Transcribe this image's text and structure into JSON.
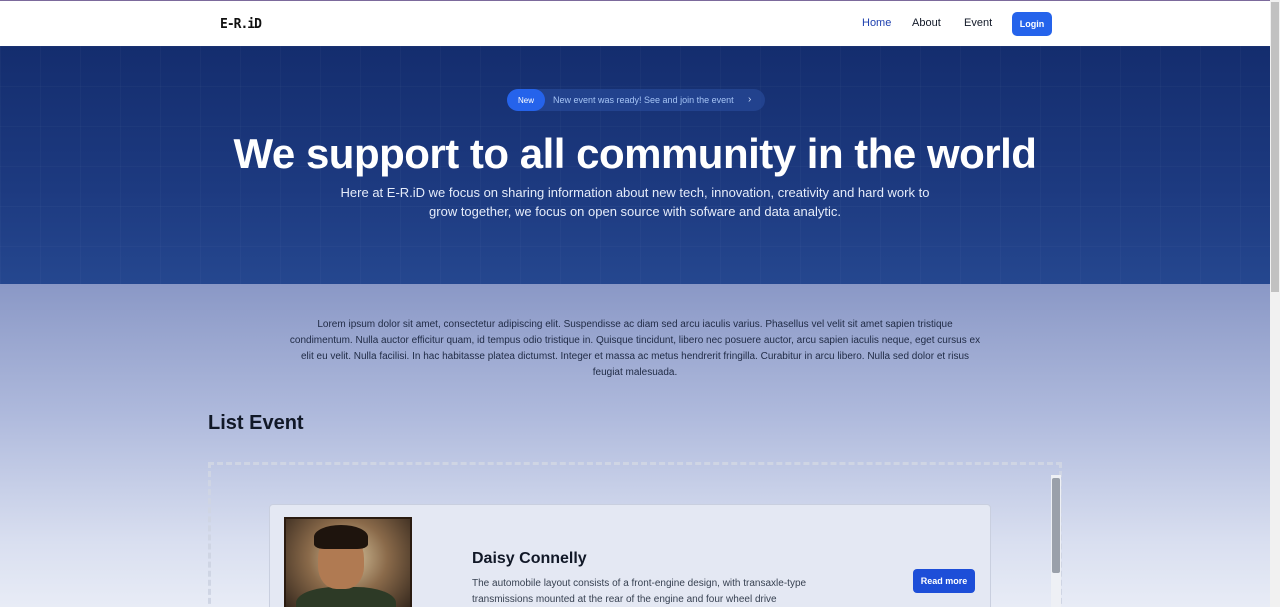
{
  "navbar": {
    "logo": "E-R.iD",
    "links": [
      {
        "label": "Home",
        "active": true
      },
      {
        "label": "About",
        "active": false
      },
      {
        "label": "Event",
        "active": false
      }
    ],
    "login_label": "Login"
  },
  "hero": {
    "badge": "New",
    "announcement": "New event was ready! See and join the event",
    "announcement_icon": "chevron-right-icon",
    "title": "We support to all community in the world",
    "description": "Here at E-R.iD we focus on sharing information about new tech, innovation, creativity and hard work to grow together, we focus on open source with sofware and data analytic."
  },
  "intro": {
    "text": "Lorem ipsum dolor sit amet, consectetur adipiscing elit. Suspendisse ac diam sed arcu iaculis varius. Phasellus vel velit sit amet sapien tristique condimentum. Nulla auctor efficitur quam, id tempus odio tristique in. Quisque tincidunt, libero nec posuere auctor, arcu sapien iaculis neque, eget cursus ex elit eu velit. Nulla facilisi. In hac habitasse platea dictumst. Integer et massa ac metus hendrerit fringilla. Curabitur in arcu libero. Nulla sed dolor et risus feugiat malesuada."
  },
  "events": {
    "section_title": "List Event",
    "items": [
      {
        "name": "Daisy Connelly",
        "description": "The automobile layout consists of a front-engine design, with transaxle-type transmissions mounted at the rear of the engine and four wheel drive",
        "button_label": "Read more"
      }
    ]
  },
  "colors": {
    "primary": "#2563eb",
    "hero_bg": "#1d3a80",
    "nav_active": "#1e40af"
  }
}
